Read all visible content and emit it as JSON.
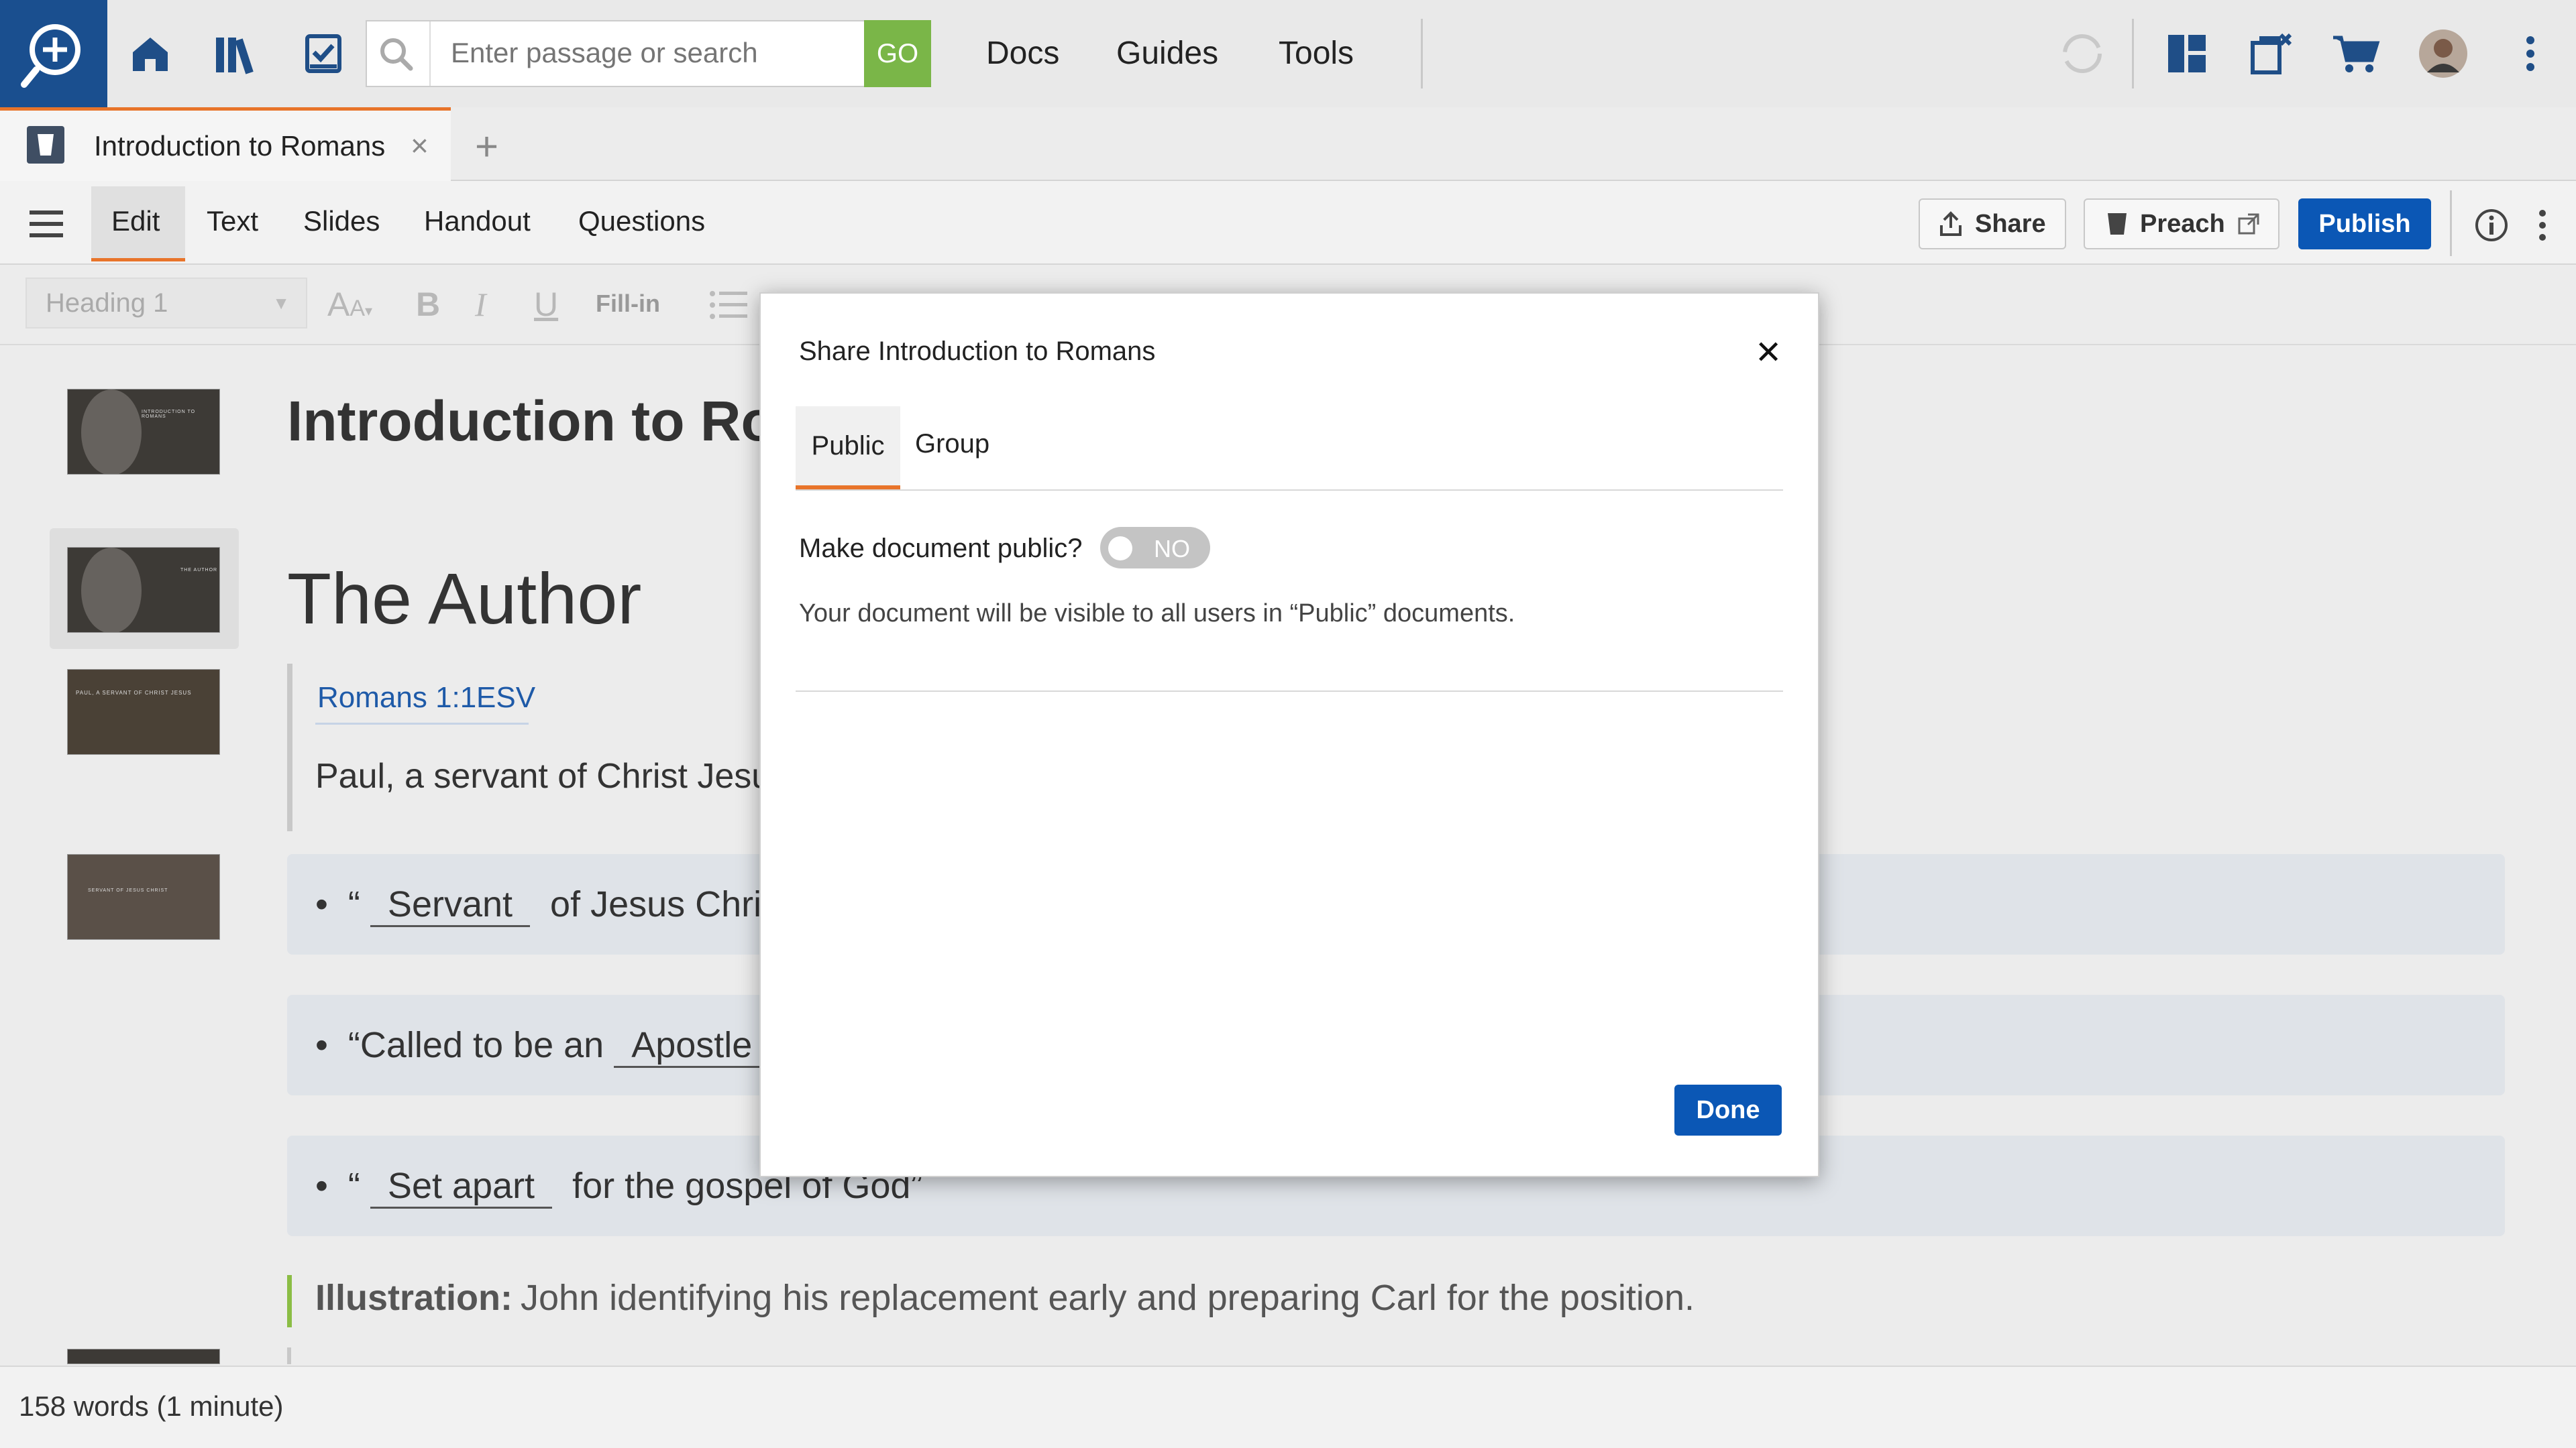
{
  "search": {
    "placeholder": "Enter passage or search",
    "go_label": "GO"
  },
  "nav": {
    "docs": "Docs",
    "guides": "Guides",
    "tools": "Tools"
  },
  "tabs": {
    "doc_tab_title": "Introduction to Romans",
    "close_glyph": "×",
    "add_glyph": "+"
  },
  "toolbar": {
    "tabs": [
      "Edit",
      "Text",
      "Slides",
      "Handout",
      "Questions"
    ],
    "share_label": "Share",
    "preach_label": "Preach",
    "publish_label": "Publish"
  },
  "format": {
    "heading_select": "Heading 1",
    "fill_in": "Fill-in"
  },
  "document": {
    "title": "Introduction to Romans",
    "section_heading": "The Author",
    "reference": "Romans 1:1",
    "version": "ESV",
    "verse_text": "Paul, a servant of Christ Jesus, called to be an apostle, set apart for the gospel of God,",
    "bullets": [
      {
        "before": "“",
        "blank": "Servant",
        "after": "of Jesus Christ”"
      },
      {
        "before": "“Called to be an",
        "blank": "Apostle",
        "after": "”"
      },
      {
        "before": "“",
        "blank": "Set apart",
        "after": "for the gospel of God”"
      }
    ],
    "illustration_label": "Illustration:",
    "illustration_text": "John identifying his replacement early and preparing Carl for the position."
  },
  "status": {
    "word_count": "158 words (1 minute)"
  },
  "modal": {
    "title": "Share Introduction to Romans",
    "close_glyph": "✕",
    "tab_public": "Public",
    "tab_group": "Group",
    "public_label": "Make document public?",
    "toggle_state": "NO",
    "description": "Your document will be visible to all users in “Public” documents.",
    "done_label": "Done"
  },
  "colors": {
    "accent_orange": "#e8742a",
    "primary_blue": "#0b57b5",
    "go_green": "#7ab648",
    "illustration_green": "#8bbd45"
  }
}
